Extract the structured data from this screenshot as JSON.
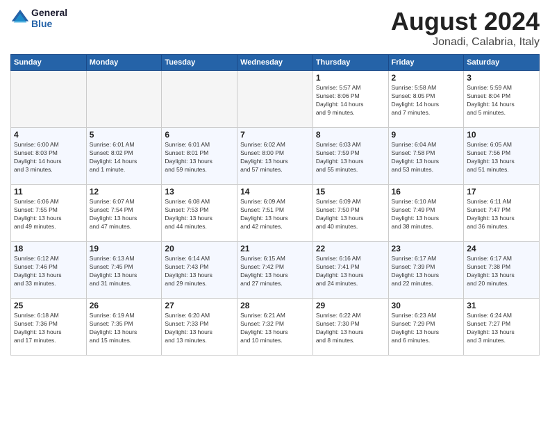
{
  "header": {
    "logo_line1": "General",
    "logo_line2": "Blue",
    "month_title": "August 2024",
    "location": "Jonadi, Calabria, Italy"
  },
  "days_of_week": [
    "Sunday",
    "Monday",
    "Tuesday",
    "Wednesday",
    "Thursday",
    "Friday",
    "Saturday"
  ],
  "weeks": [
    [
      {
        "day": "",
        "info": ""
      },
      {
        "day": "",
        "info": ""
      },
      {
        "day": "",
        "info": ""
      },
      {
        "day": "",
        "info": ""
      },
      {
        "day": "1",
        "info": "Sunrise: 5:57 AM\nSunset: 8:06 PM\nDaylight: 14 hours\nand 9 minutes."
      },
      {
        "day": "2",
        "info": "Sunrise: 5:58 AM\nSunset: 8:05 PM\nDaylight: 14 hours\nand 7 minutes."
      },
      {
        "day": "3",
        "info": "Sunrise: 5:59 AM\nSunset: 8:04 PM\nDaylight: 14 hours\nand 5 minutes."
      }
    ],
    [
      {
        "day": "4",
        "info": "Sunrise: 6:00 AM\nSunset: 8:03 PM\nDaylight: 14 hours\nand 3 minutes."
      },
      {
        "day": "5",
        "info": "Sunrise: 6:01 AM\nSunset: 8:02 PM\nDaylight: 14 hours\nand 1 minute."
      },
      {
        "day": "6",
        "info": "Sunrise: 6:01 AM\nSunset: 8:01 PM\nDaylight: 13 hours\nand 59 minutes."
      },
      {
        "day": "7",
        "info": "Sunrise: 6:02 AM\nSunset: 8:00 PM\nDaylight: 13 hours\nand 57 minutes."
      },
      {
        "day": "8",
        "info": "Sunrise: 6:03 AM\nSunset: 7:59 PM\nDaylight: 13 hours\nand 55 minutes."
      },
      {
        "day": "9",
        "info": "Sunrise: 6:04 AM\nSunset: 7:58 PM\nDaylight: 13 hours\nand 53 minutes."
      },
      {
        "day": "10",
        "info": "Sunrise: 6:05 AM\nSunset: 7:56 PM\nDaylight: 13 hours\nand 51 minutes."
      }
    ],
    [
      {
        "day": "11",
        "info": "Sunrise: 6:06 AM\nSunset: 7:55 PM\nDaylight: 13 hours\nand 49 minutes."
      },
      {
        "day": "12",
        "info": "Sunrise: 6:07 AM\nSunset: 7:54 PM\nDaylight: 13 hours\nand 47 minutes."
      },
      {
        "day": "13",
        "info": "Sunrise: 6:08 AM\nSunset: 7:53 PM\nDaylight: 13 hours\nand 44 minutes."
      },
      {
        "day": "14",
        "info": "Sunrise: 6:09 AM\nSunset: 7:51 PM\nDaylight: 13 hours\nand 42 minutes."
      },
      {
        "day": "15",
        "info": "Sunrise: 6:09 AM\nSunset: 7:50 PM\nDaylight: 13 hours\nand 40 minutes."
      },
      {
        "day": "16",
        "info": "Sunrise: 6:10 AM\nSunset: 7:49 PM\nDaylight: 13 hours\nand 38 minutes."
      },
      {
        "day": "17",
        "info": "Sunrise: 6:11 AM\nSunset: 7:47 PM\nDaylight: 13 hours\nand 36 minutes."
      }
    ],
    [
      {
        "day": "18",
        "info": "Sunrise: 6:12 AM\nSunset: 7:46 PM\nDaylight: 13 hours\nand 33 minutes."
      },
      {
        "day": "19",
        "info": "Sunrise: 6:13 AM\nSunset: 7:45 PM\nDaylight: 13 hours\nand 31 minutes."
      },
      {
        "day": "20",
        "info": "Sunrise: 6:14 AM\nSunset: 7:43 PM\nDaylight: 13 hours\nand 29 minutes."
      },
      {
        "day": "21",
        "info": "Sunrise: 6:15 AM\nSunset: 7:42 PM\nDaylight: 13 hours\nand 27 minutes."
      },
      {
        "day": "22",
        "info": "Sunrise: 6:16 AM\nSunset: 7:41 PM\nDaylight: 13 hours\nand 24 minutes."
      },
      {
        "day": "23",
        "info": "Sunrise: 6:17 AM\nSunset: 7:39 PM\nDaylight: 13 hours\nand 22 minutes."
      },
      {
        "day": "24",
        "info": "Sunrise: 6:17 AM\nSunset: 7:38 PM\nDaylight: 13 hours\nand 20 minutes."
      }
    ],
    [
      {
        "day": "25",
        "info": "Sunrise: 6:18 AM\nSunset: 7:36 PM\nDaylight: 13 hours\nand 17 minutes."
      },
      {
        "day": "26",
        "info": "Sunrise: 6:19 AM\nSunset: 7:35 PM\nDaylight: 13 hours\nand 15 minutes."
      },
      {
        "day": "27",
        "info": "Sunrise: 6:20 AM\nSunset: 7:33 PM\nDaylight: 13 hours\nand 13 minutes."
      },
      {
        "day": "28",
        "info": "Sunrise: 6:21 AM\nSunset: 7:32 PM\nDaylight: 13 hours\nand 10 minutes."
      },
      {
        "day": "29",
        "info": "Sunrise: 6:22 AM\nSunset: 7:30 PM\nDaylight: 13 hours\nand 8 minutes."
      },
      {
        "day": "30",
        "info": "Sunrise: 6:23 AM\nSunset: 7:29 PM\nDaylight: 13 hours\nand 6 minutes."
      },
      {
        "day": "31",
        "info": "Sunrise: 6:24 AM\nSunset: 7:27 PM\nDaylight: 13 hours\nand 3 minutes."
      }
    ]
  ]
}
